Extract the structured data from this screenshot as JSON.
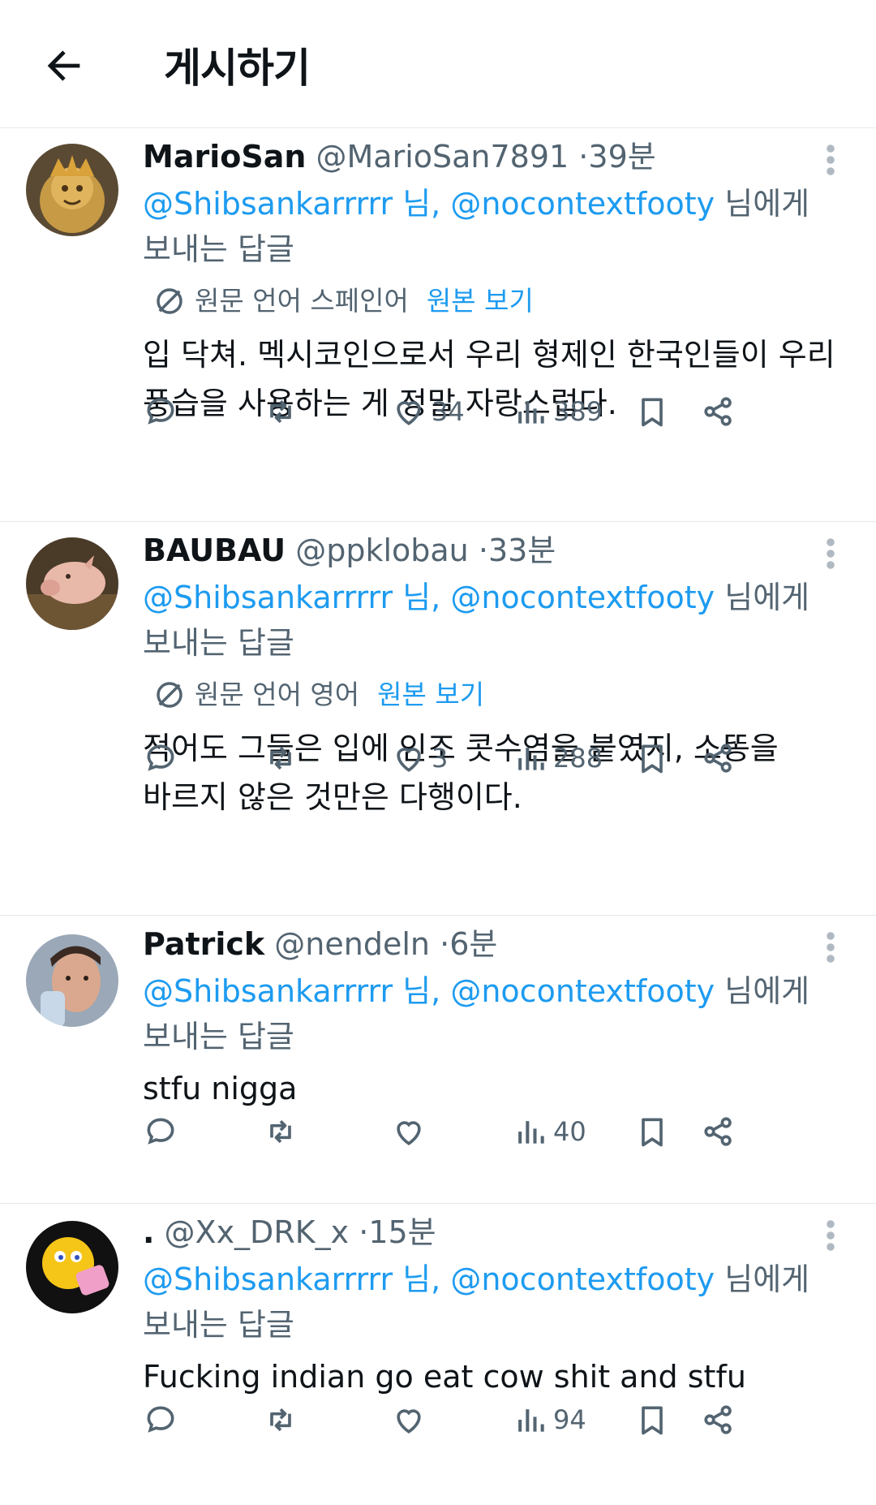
{
  "header": {
    "title": "게시하기"
  },
  "posts": [
    {
      "username": "MarioSan",
      "handle": "@MarioSan7891",
      "time": "39분",
      "reply_to": {
        "mention1": "@Shibsankarrrrr 님,",
        "mention2": "@nocontextfooty",
        "suffix_line1": "님에게",
        "suffix_line2": "보내는 답글"
      },
      "translation": {
        "label": "원문 언어 스페인어",
        "action": "원본 보기"
      },
      "text_lines": [
        "입 닥쳐. 멕시코인으로서 우리 형제인 한국인들이 우리",
        "풍습을 사용하는 게 정말 자랑스럽다."
      ],
      "likes": "34",
      "views": "389"
    },
    {
      "username": "BAUBAU",
      "handle": "@ppklobau",
      "time": "33분",
      "reply_to": {
        "mention1": "@Shibsankarrrrr 님,",
        "mention2": "@nocontextfooty",
        "suffix_line1": "님에게",
        "suffix_line2": "보내는 답글"
      },
      "translation": {
        "label": "원문 언어 영어",
        "action": "원본 보기"
      },
      "text_lines": [
        "적어도 그들은 입에 인조 콧수염을 붙였지, 소똥을",
        "바르지 않은 것만은 다행이다."
      ],
      "likes": "3",
      "views": "288"
    },
    {
      "username": "Patrick",
      "handle": "@nendeln",
      "time": "6분",
      "reply_to": {
        "mention1": "@Shibsankarrrrr 님,",
        "mention2": "@nocontextfooty",
        "suffix_line1": "님에게",
        "suffix_line2": "보내는 답글"
      },
      "text_lines": [
        "stfu nigga"
      ],
      "likes": "",
      "views": "40"
    },
    {
      "username": ".",
      "handle": "@Xx_DRK_x",
      "time": "15분",
      "reply_to": {
        "mention1": "@Shibsankarrrrr 님,",
        "mention2": "@nocontextfooty",
        "suffix_line1": "님에게",
        "suffix_line2": "보내는 답글"
      },
      "text_lines": [
        "Fucking indian go eat cow shit and stfu"
      ],
      "likes": "",
      "views": "94"
    }
  ],
  "icons": {
    "back": "arrow-left-icon",
    "more": "more-vertical-icon",
    "translate": "translate-icon",
    "reply": "reply-icon",
    "repost": "repost-icon",
    "like": "heart-icon",
    "views": "views-icon",
    "bookmark": "bookmark-icon",
    "share": "share-icon"
  },
  "colors": {
    "link": "#1d9bf0",
    "secondary": "#536471",
    "text": "#0f1419",
    "divider": "#e6e9ec"
  }
}
